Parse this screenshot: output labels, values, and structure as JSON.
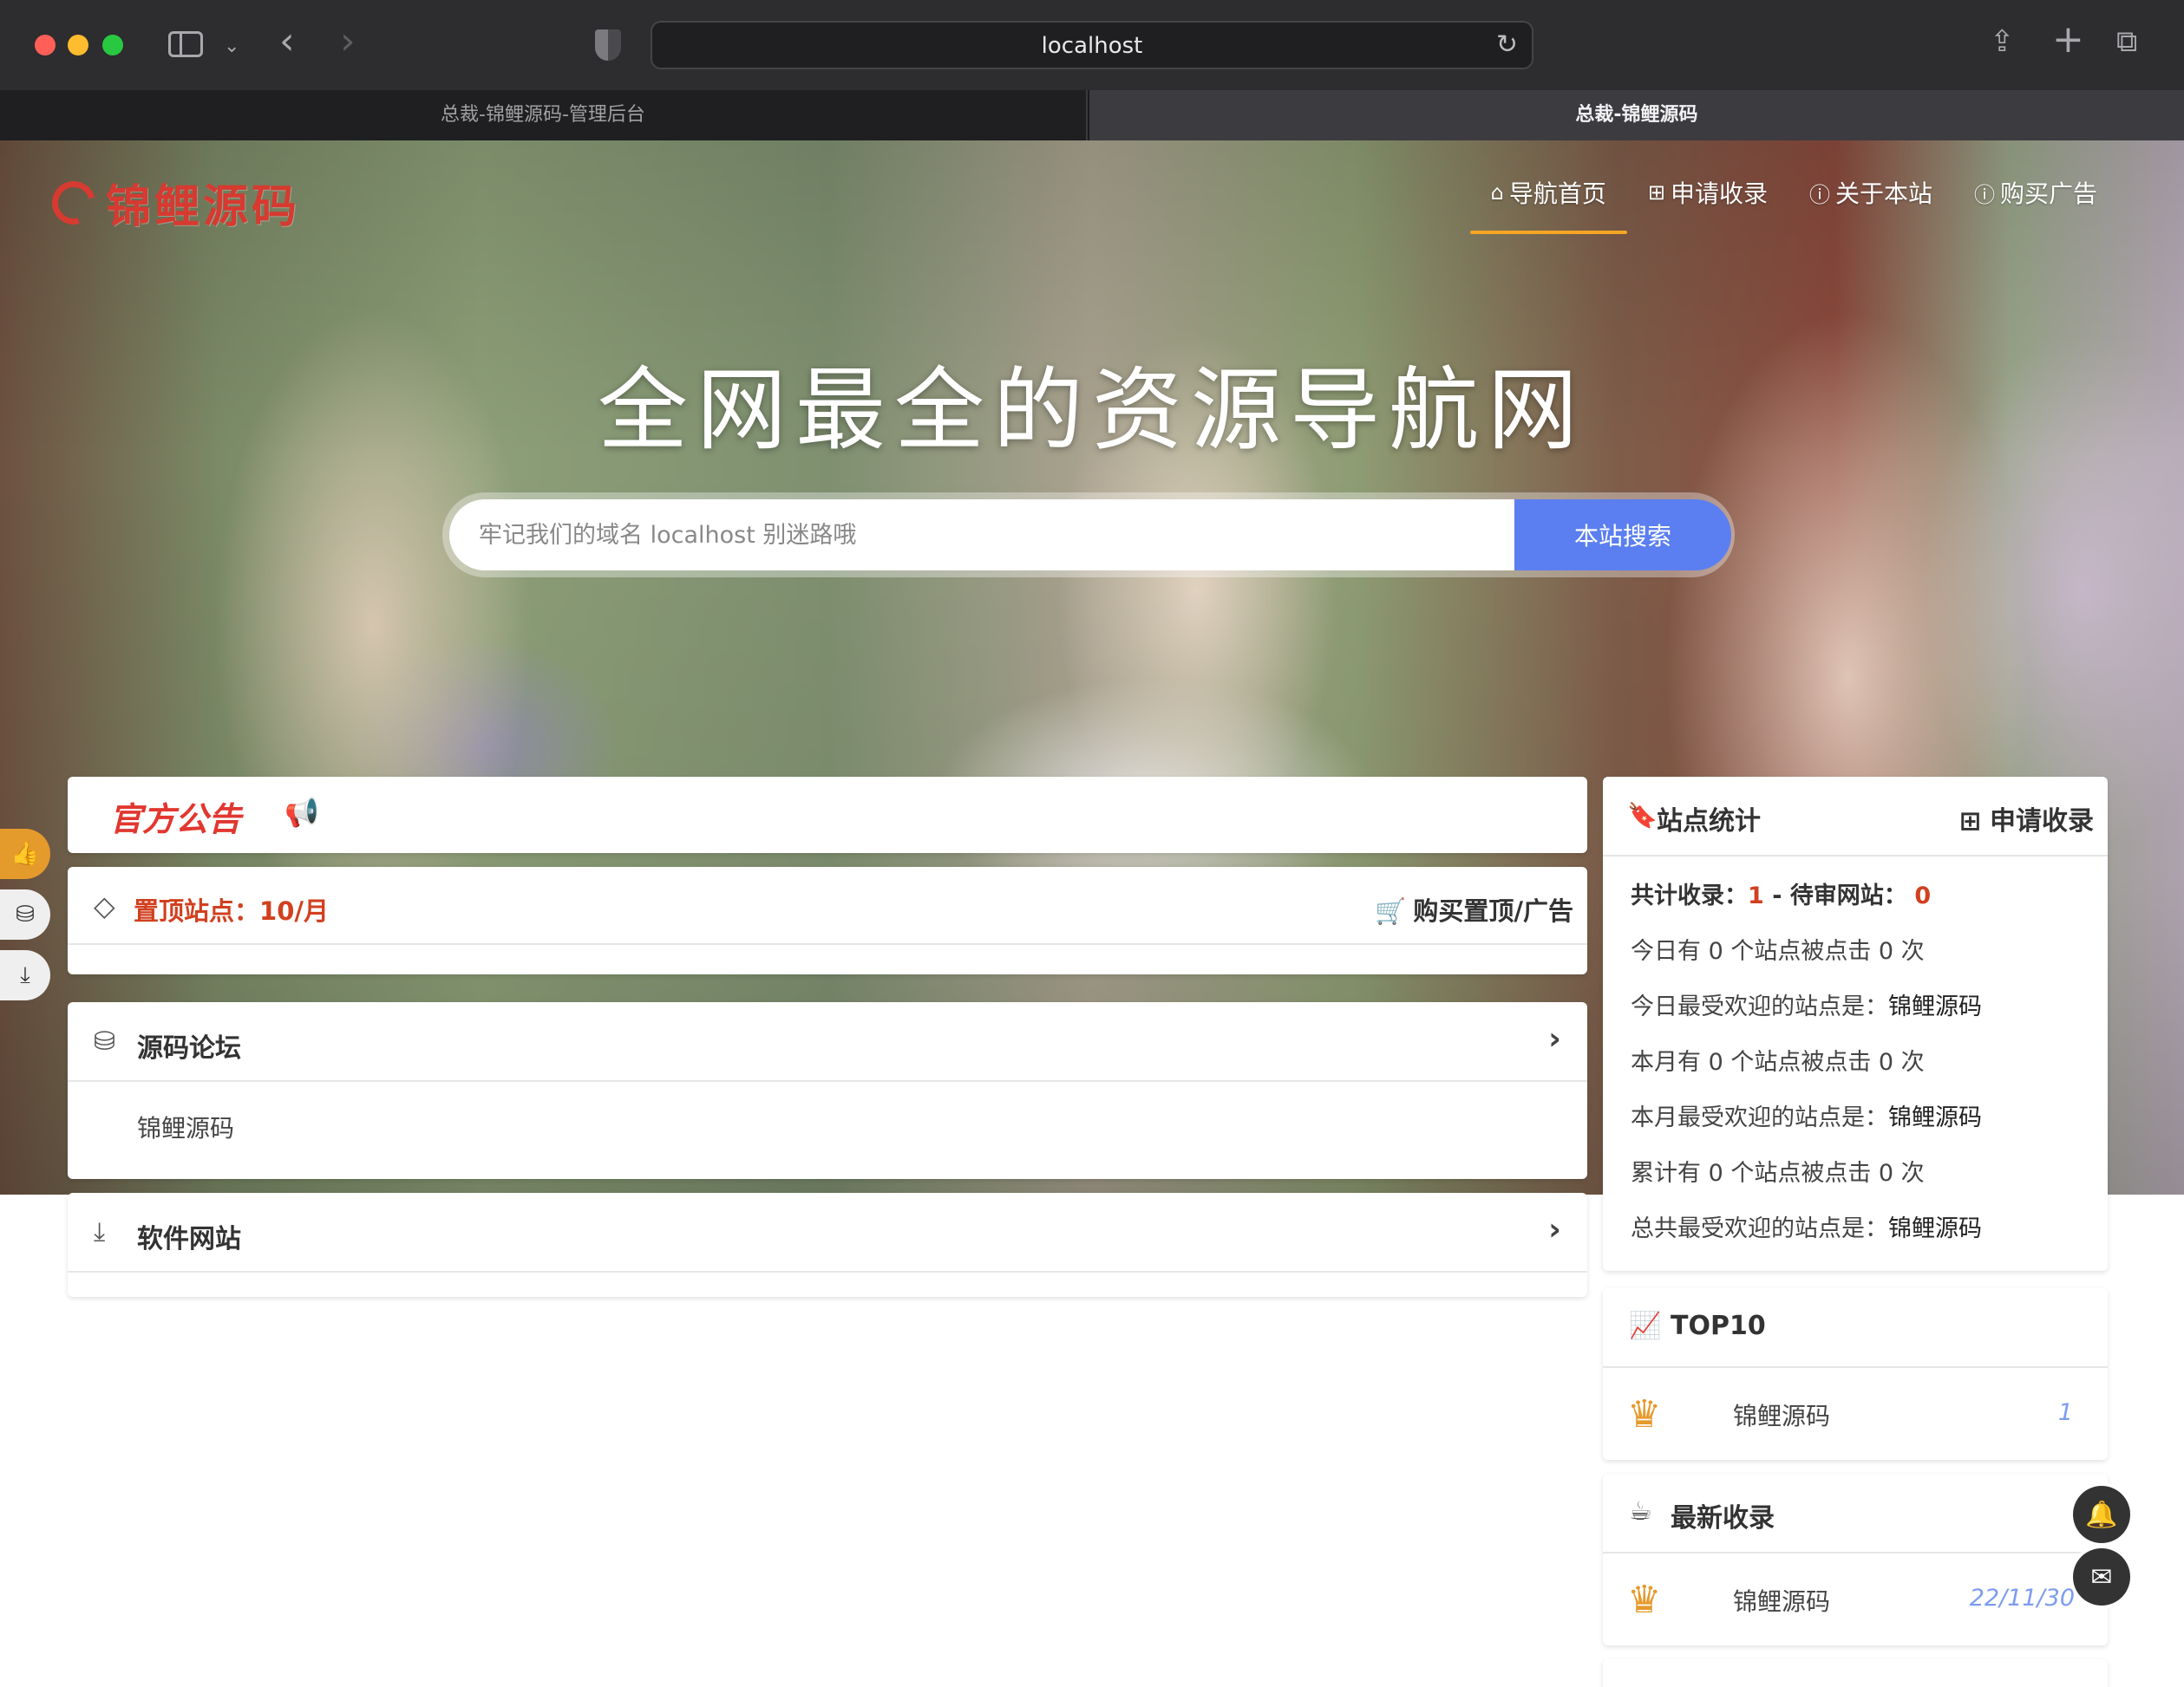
{
  "browser": {
    "url": "localhost",
    "tabs": [
      {
        "label": "总裁-锦鲤源码-管理后台"
      },
      {
        "label": "总裁-锦鲤源码"
      }
    ]
  },
  "site": {
    "logo": "锦鲤源码",
    "nav": [
      {
        "label": "导航首页",
        "icon": "home-icon"
      },
      {
        "label": "申请收录",
        "icon": "plus-square-icon"
      },
      {
        "label": "关于本站",
        "icon": "info-icon"
      },
      {
        "label": "购买广告",
        "icon": "info-icon"
      }
    ],
    "hero_title": "全网最全的资源导航网",
    "search": {
      "placeholder": "牢记我们的域名 localhost 别迷路哦",
      "button": "本站搜索"
    }
  },
  "notice": {
    "title": "官方公告",
    "icon": "megaphone-icon"
  },
  "pinned": {
    "label": "置顶站点：",
    "value": "10/月",
    "buy": "购买置顶/广告"
  },
  "categories": [
    {
      "title": "源码论坛",
      "icon": "cubes-icon",
      "links": [
        "锦鲤源码"
      ]
    },
    {
      "title": "软件网站",
      "icon": "download-icon",
      "links": []
    }
  ],
  "stats": {
    "title": "站点统计",
    "apply": "申请收录",
    "total_label": "共计收录：",
    "total_value": "1",
    "sep": " - ",
    "pending_label": "待审网站：",
    "pending_value": "0",
    "rows": [
      {
        "text": "今日有 0 个站点被点击 0 次"
      },
      {
        "text": "今日最受欢迎的站点是：",
        "site": "锦鲤源码"
      },
      {
        "text": "本月有 0 个站点被点击 0 次"
      },
      {
        "text": "本月最受欢迎的站点是：",
        "site": "锦鲤源码"
      },
      {
        "text": "累计有 0 个站点被点击 0 次"
      },
      {
        "text": "总共最受欢迎的站点是：",
        "site": "锦鲤源码"
      }
    ]
  },
  "top10": {
    "title": "TOP10",
    "items": [
      {
        "name": "锦鲤源码",
        "count": "1"
      }
    ]
  },
  "latest": {
    "title": "最新收录",
    "items": [
      {
        "name": "锦鲤源码",
        "date": "22/11/30"
      }
    ]
  },
  "colors": {
    "accent": "#5b7ff0",
    "brand_red": "#d63a30",
    "nav_active": "#f5a623",
    "thumb_btn": "#e59a2c"
  }
}
